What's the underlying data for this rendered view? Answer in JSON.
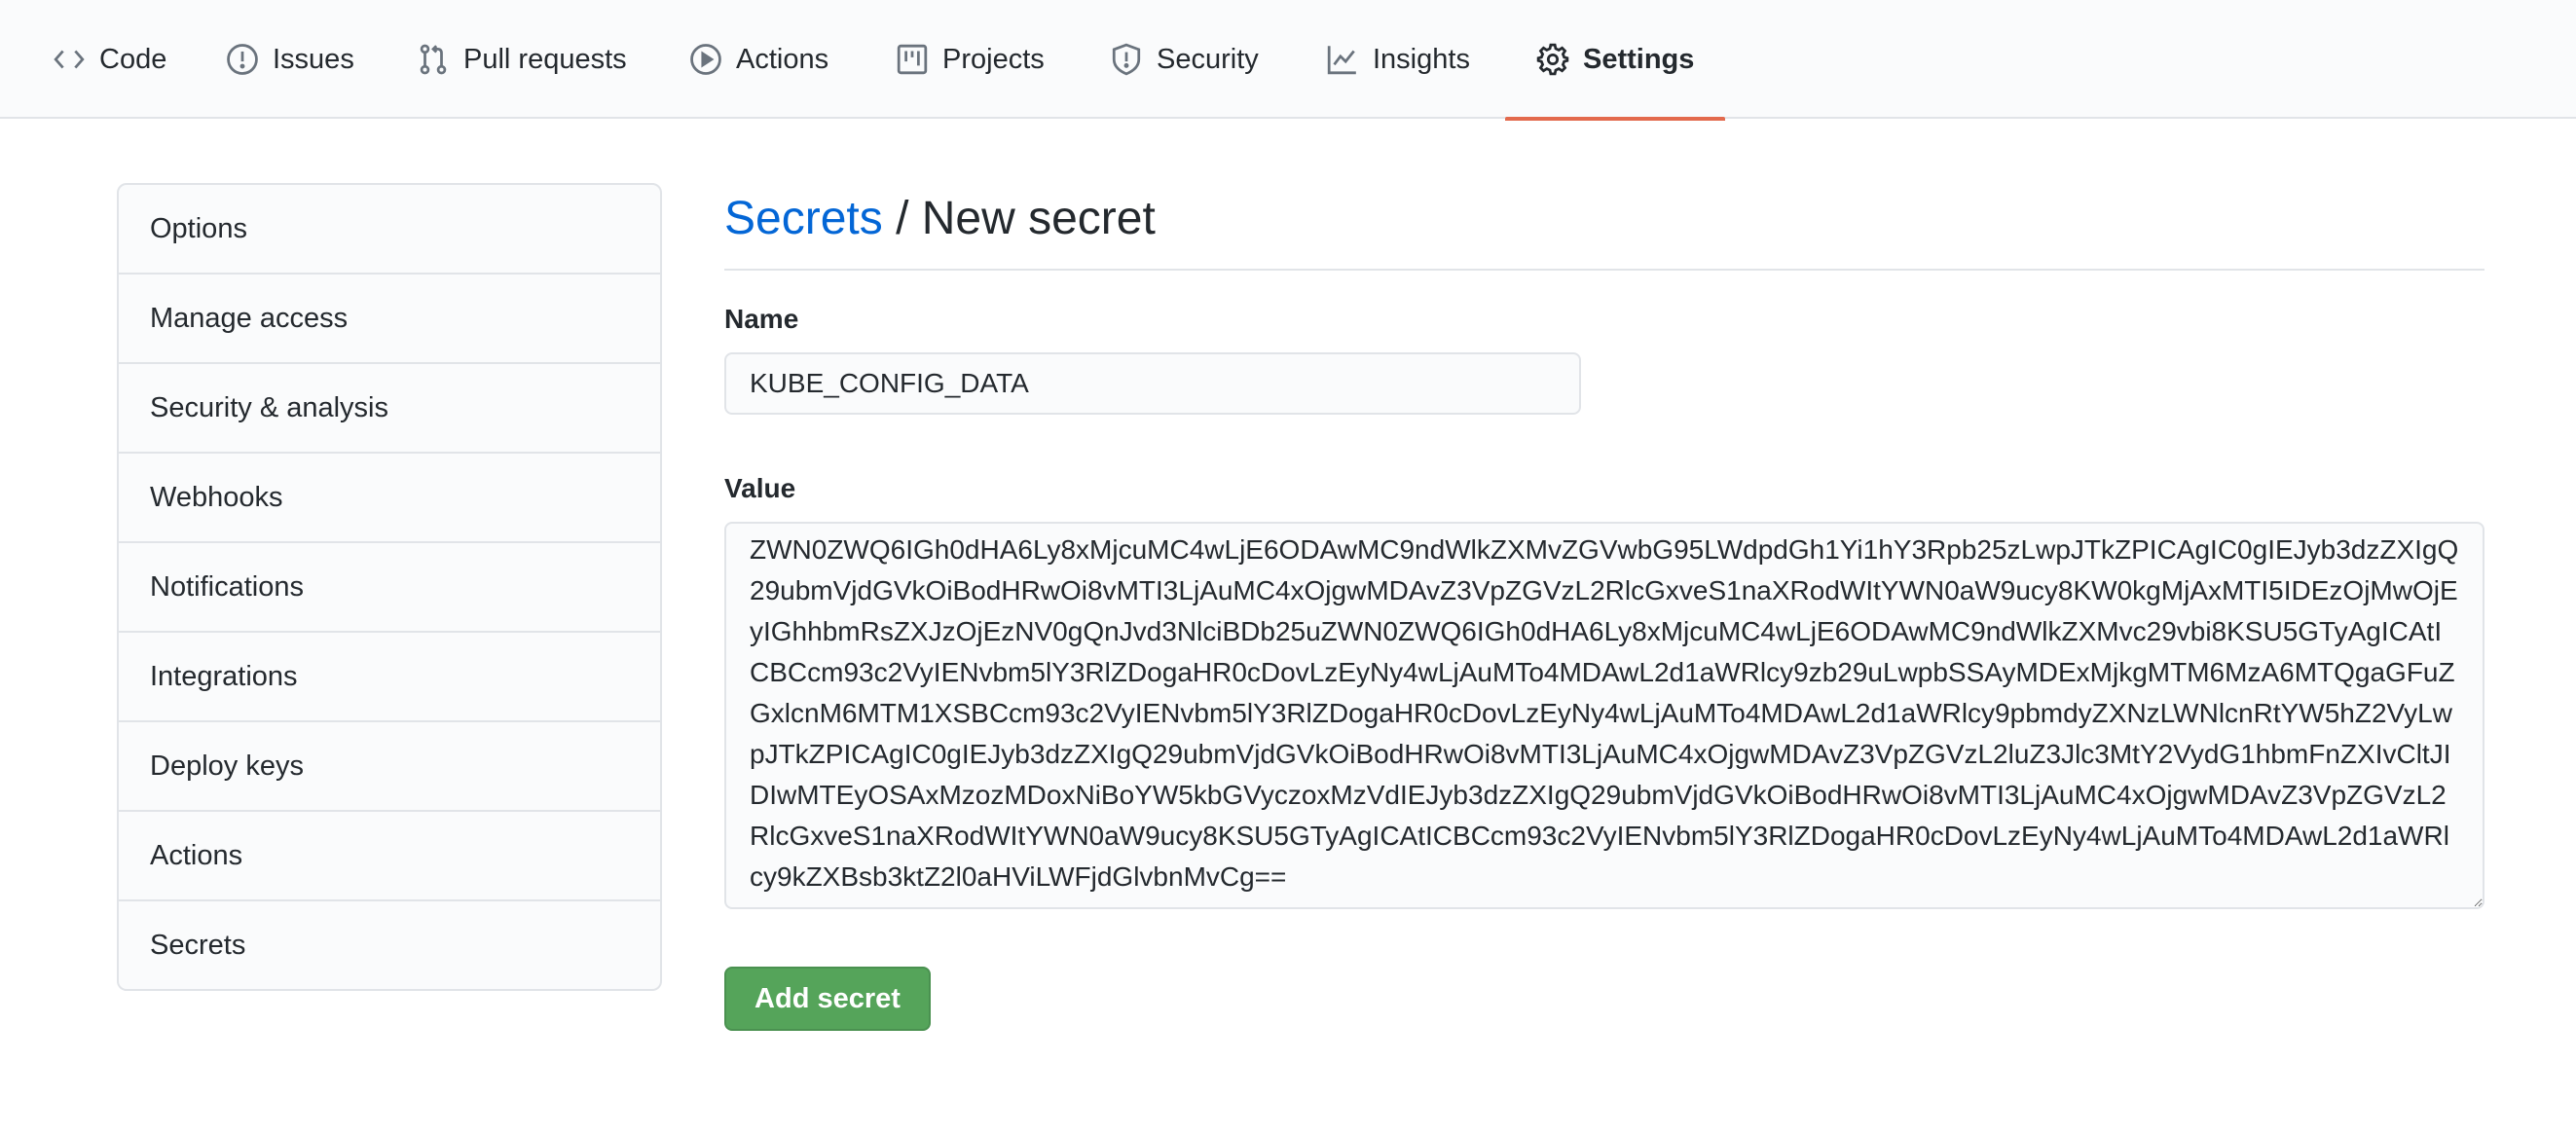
{
  "tabs": [
    {
      "label": "Code",
      "icon": "code-icon",
      "active": false
    },
    {
      "label": "Issues",
      "icon": "issue-icon",
      "active": false
    },
    {
      "label": "Pull requests",
      "icon": "pull-request-icon",
      "active": false
    },
    {
      "label": "Actions",
      "icon": "play-icon",
      "active": false
    },
    {
      "label": "Projects",
      "icon": "project-icon",
      "active": false
    },
    {
      "label": "Security",
      "icon": "shield-icon",
      "active": false
    },
    {
      "label": "Insights",
      "icon": "graph-icon",
      "active": false
    },
    {
      "label": "Settings",
      "icon": "gear-icon",
      "active": true
    }
  ],
  "sidebar": {
    "items": [
      {
        "label": "Options"
      },
      {
        "label": "Manage access"
      },
      {
        "label": "Security & analysis"
      },
      {
        "label": "Webhooks"
      },
      {
        "label": "Notifications"
      },
      {
        "label": "Integrations"
      },
      {
        "label": "Deploy keys"
      },
      {
        "label": "Actions"
      },
      {
        "label": "Secrets"
      }
    ]
  },
  "main": {
    "breadcrumb_link": "Secrets",
    "breadcrumb_separator": " / ",
    "title": "New secret",
    "name_label": "Name",
    "name_value": "KUBE_CONFIG_DATA",
    "value_label": "Value",
    "value_text": "ZWN0ZWQ6IGh0dHA6Ly8xMjcuMC4wLjE6ODAwMC9ndWlkZXMvZGVwbG95LWdpdGh1Yi1hY3Rpb25zLwpJTkZPICAgIC0gIEJyb3dzZXIgQ29ubmVjdGVkOiBodHRwOi8vMTI3LjAuMC4xOjgwMDAvZ3VpZGVzL2RlcGxveS1naXRodWItYWN0aW9ucy8KW0kgMjAxMTI5IDEzOjMwOjEyIGhhbmRsZXJzOjEzNV0gQnJvd3NlciBDb25uZWN0ZWQ6IGh0dHA6Ly8xMjcuMC4wLjE6ODAwMC9ndWlkZXMvc29vbi8KSU5GTyAgICAtICBCcm93c2VyIENvbm5lY3RlZDogaHR0cDovLzEyNy4wLjAuMTo4MDAwL2d1aWRlcy9zb29uLwpbSSAyMDExMjkgMTM6MzA6MTQgaGFuZGxlcnM6MTM1XSBCcm93c2VyIENvbm5lY3RlZDogaHR0cDovLzEyNy4wLjAuMTo4MDAwL2d1aWRlcy9pbmdyZXNzLWNlcnRtYW5hZ2VyLwpJTkZPICAgIC0gIEJyb3dzZXIgQ29ubmVjdGVkOiBodHRwOi8vMTI3LjAuMC4xOjgwMDAvZ3VpZGVzL2luZ3Jlc3MtY2VydG1hbmFnZXIvCltJIDIwMTEyOSAxMzozMDoxNiBoYW5kbGVyczoxMzVdIEJyb3dzZXIgQ29ubmVjdGVkOiBodHRwOi8vMTI3LjAuMC4xOjgwMDAvZ3VpZGVzL2RlcGxveS1naXRodWItYWN0aW9ucy8KSU5GTyAgICAtICBCcm93c2VyIENvbm5lY3RlZDogaHR0cDovLzEyNy4wLjAuMTo4MDAwL2d1aWRlcy9kZXBsb3ktZ2l0aHViLWFjdGlvbnMvCg==",
    "submit_label": "Add secret"
  },
  "colors": {
    "link": "#0366d6",
    "active_tab_underline": "#e36a4d",
    "submit_bg": "#55a45a"
  }
}
